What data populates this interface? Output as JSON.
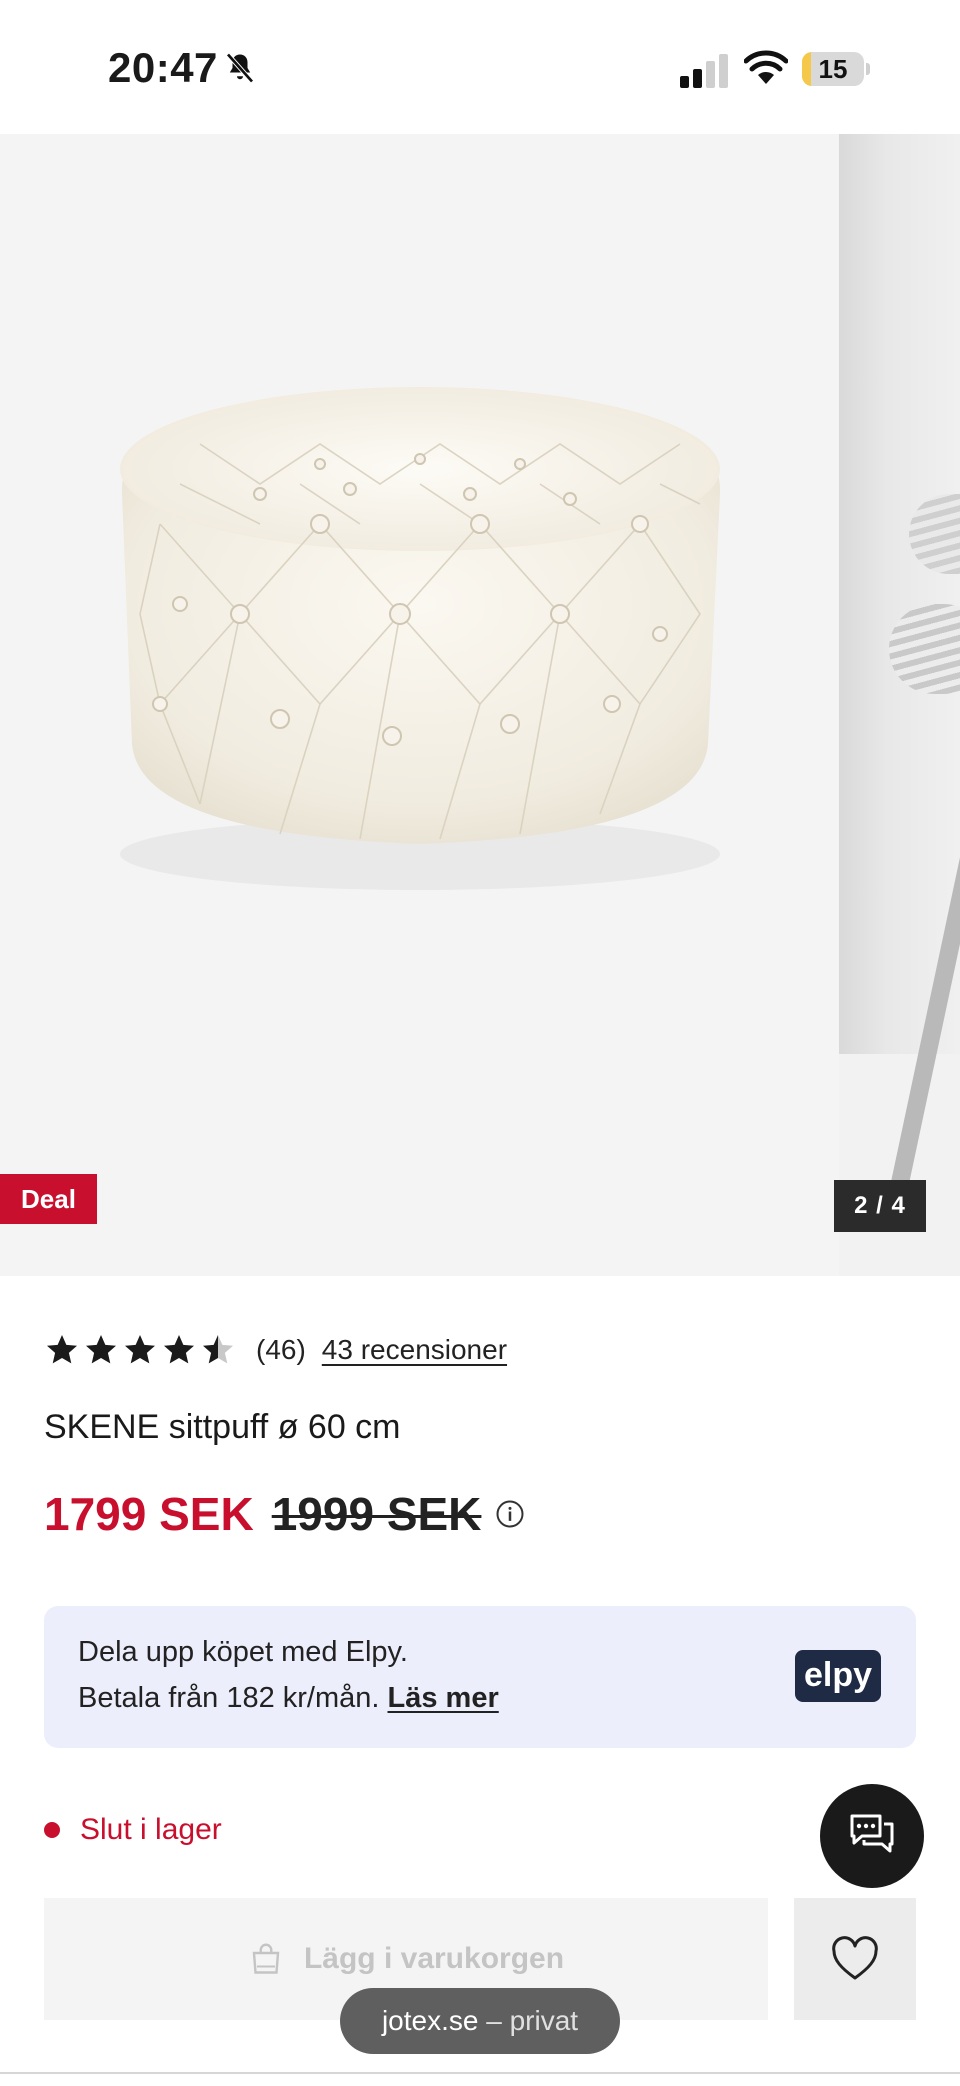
{
  "status_bar": {
    "time": "20:47",
    "battery_percent": "15",
    "battery_level": 0.15,
    "silent_icon": "bell-slash-icon"
  },
  "gallery": {
    "badge": "Deal",
    "counter": "2 / 4",
    "current_image": 2,
    "total_images": 4
  },
  "product": {
    "rating_value": 4.5,
    "rating_count": "(46)",
    "reviews_link": "43 recensioner",
    "title": "SKENE sittpuff ø 60 cm",
    "price_now": "1799 SEK",
    "price_old": "1999 SEK"
  },
  "elpy": {
    "line1": "Dela upp köpet med Elpy.",
    "line2_prefix": "Betala från 182 kr/mån.",
    "link": "Läs mer",
    "logo": "elpy"
  },
  "stock": {
    "label": "Slut i lager"
  },
  "actions": {
    "add_to_cart": "Lägg i varukorgen"
  },
  "browser": {
    "domain": "jotex.se",
    "mode": "– privat"
  },
  "colors": {
    "accent_red": "#c8102e",
    "elpy_bg": "#eceefc",
    "elpy_logo": "#1f2a44"
  }
}
